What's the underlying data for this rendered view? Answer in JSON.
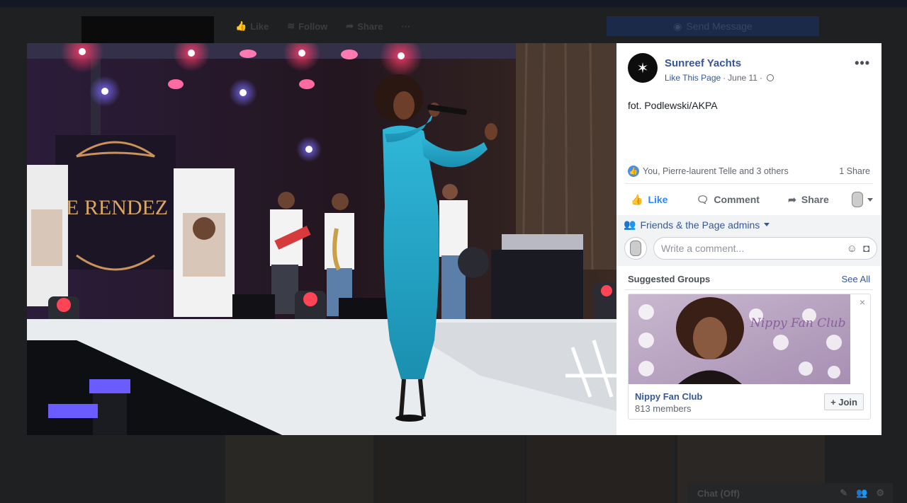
{
  "background_page": {
    "like_label": "Like",
    "follow_label": "Follow",
    "share_label": "Share",
    "more_label": "···",
    "send_message_label": "Send Message",
    "chat_label": "Chat (Off)"
  },
  "photo": {
    "banner_left_text": "IE RENDEZ",
    "accent_colors": [
      "#ff2a55",
      "#2e6fb8",
      "#1dbce0"
    ]
  },
  "post": {
    "page_name": "Sunreef Yachts",
    "like_this_page": "Like This Page",
    "separator": "·",
    "date": "June 11",
    "more": "•••",
    "caption": "fot. Podlewski/AKPA",
    "reactions_text": "You, Pierre-laurent Telle and 3 others",
    "shares_text": "1 Share"
  },
  "actions": {
    "like": "Like",
    "comment": "Comment",
    "share": "Share"
  },
  "comments": {
    "audience": "Friends & the Page admins",
    "placeholder": "Write a comment..."
  },
  "suggested_groups": {
    "title": "Suggested Groups",
    "see_all": "See All",
    "group_name": "Nippy Fan Club",
    "members": "813 members",
    "join": "+ Join",
    "image_text": "Nippy Fan Club",
    "close": "×"
  }
}
